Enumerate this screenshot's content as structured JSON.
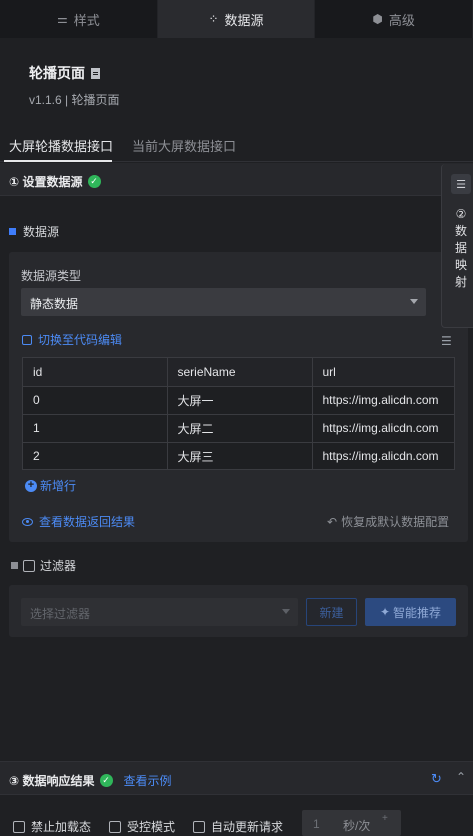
{
  "tabs": [
    {
      "label": "样式",
      "icon": "sliders-icon"
    },
    {
      "label": "数据源",
      "icon": "grid-icon"
    },
    {
      "label": "高级",
      "icon": "cube-icon"
    }
  ],
  "header": {
    "title": "轮播页面",
    "version": "v1.1.6 | 轮播页面"
  },
  "subtabs": [
    "大屏轮播数据接口",
    "当前大屏数据接口"
  ],
  "section1": {
    "title": "① 设置数据源"
  },
  "side_panel": {
    "toggle": "☰",
    "label": "② 数据映射"
  },
  "datasource": {
    "label": "数据源",
    "type_label": "数据源类型",
    "type_value": "静态数据",
    "switch_code": "切换至代码编辑",
    "table": {
      "columns": [
        "id",
        "serieName",
        "url"
      ],
      "rows": [
        [
          "0",
          "大屏一",
          "https://img.alicdn.com"
        ],
        [
          "1",
          "大屏二",
          "https://img.alicdn.com"
        ],
        [
          "2",
          "大屏三",
          "https://img.alicdn.com"
        ]
      ]
    },
    "add_row": "新增行",
    "view_result": "查看数据返回结果",
    "restore": "恢复成默认数据配置"
  },
  "filter": {
    "label": "过滤器",
    "select_placeholder": "选择过滤器",
    "new_button": "新建",
    "smart_button": "智能推荐"
  },
  "section3": {
    "title": "③ 数据响应结果",
    "example_link": "查看示例"
  },
  "options": {
    "disable_loading": "禁止加载态",
    "controlled_mode": "受控模式",
    "auto_update": "自动更新请求",
    "interval_value": "1",
    "interval_unit": "秒/次"
  },
  "colors": {
    "accent": "#4c8bf5",
    "success": "#2fb65a",
    "background": "#1f2023"
  }
}
